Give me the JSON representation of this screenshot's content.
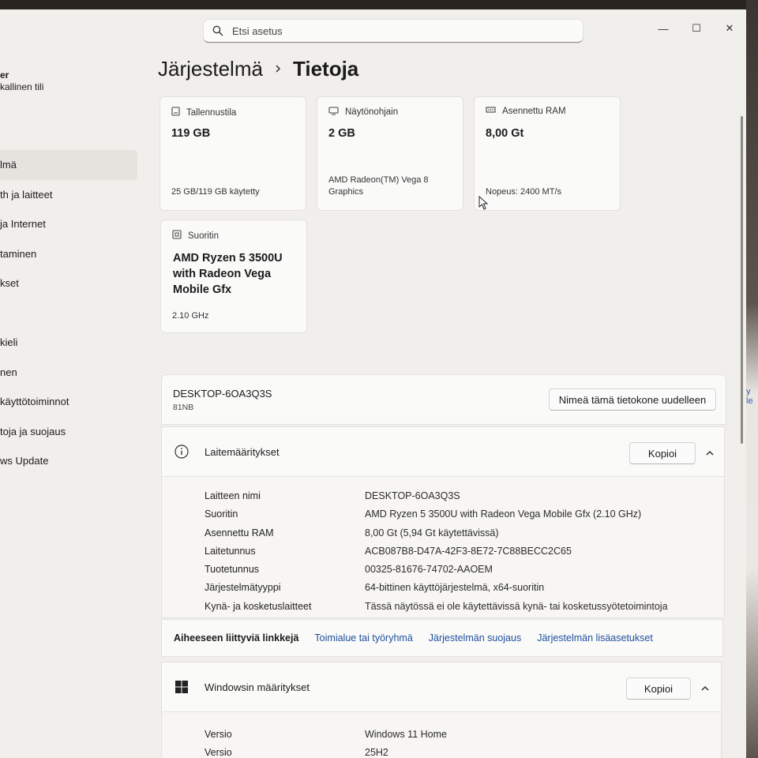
{
  "search": {
    "placeholder": "Etsi asetus"
  },
  "window_controls": {
    "minimize": "—",
    "maximize": "☐",
    "close": "✕"
  },
  "sidebar": {
    "user_name": "er",
    "user_sub": "kallinen tili",
    "items": [
      {
        "label": "lmä",
        "active": true
      },
      {
        "label": "th ja laitteet"
      },
      {
        "label": "ja Internet"
      },
      {
        "label": "taminen"
      },
      {
        "label": "kset"
      },
      {
        "label": ""
      },
      {
        "label": "kieli"
      },
      {
        "label": "nen"
      },
      {
        "label": "käyttötoiminnot"
      },
      {
        "label": "toja ja suojaus"
      },
      {
        "label": "ws Update"
      }
    ]
  },
  "breadcrumb": {
    "parent": "Järjestelmä",
    "current": "Tietoja"
  },
  "cards": {
    "storage": {
      "label": "Tallennustila",
      "value": "119 GB",
      "sub": "25 GB/119 GB käytetty"
    },
    "gpu": {
      "label": "Näytönohjain",
      "value": "2 GB",
      "sub": "AMD Radeon(TM) Vega 8 Graphics"
    },
    "ram": {
      "label": "Asennettu RAM",
      "value": "8,00 Gt",
      "sub": "Nopeus: 2400 MT/s"
    },
    "cpu": {
      "label": "Suoritin",
      "value": "AMD Ryzen 5 3500U with Radeon Vega Mobile Gfx",
      "sub": "2.10 GHz"
    }
  },
  "device": {
    "name": "DESKTOP-6OA3Q3S",
    "model": "81NB",
    "rename_button": "Nimeä tämä tietokone uudelleen"
  },
  "device_specs": {
    "title": "Laitemääritykset",
    "copy_button": "Kopioi",
    "rows": [
      {
        "key": "Laitteen nimi",
        "value": "DESKTOP-6OA3Q3S"
      },
      {
        "key": "Suoritin",
        "value": "AMD Ryzen 5 3500U with Radeon Vega Mobile Gfx   (2.10 GHz)"
      },
      {
        "key": "Asennettu RAM",
        "value": "8,00 Gt (5,94 Gt käytettävissä)"
      },
      {
        "key": "Laitetunnus",
        "value": "ACB087B8-D47A-42F3-8E72-7C88BECC2C65"
      },
      {
        "key": "Tuotetunnus",
        "value": "00325-81676-74702-AAOEM"
      },
      {
        "key": "Järjestelmätyyppi",
        "value": "64-bittinen käyttöjärjestelmä, x64-suoritin"
      },
      {
        "key": "Kynä- ja kosketuslaitteet",
        "value": "Tässä näytössä ei ole käytettävissä kynä- tai kosketussyötetoimintoja"
      }
    ]
  },
  "related_links": {
    "heading": "Aiheeseen liittyviä linkkejä",
    "links": [
      "Toimialue tai työryhmä",
      "Järjestelmän suojaus",
      "Järjestelmän lisäasetukset"
    ]
  },
  "windows_specs": {
    "title": "Windowsin määritykset",
    "copy_button": "Kopioi",
    "rows": [
      {
        "key": "Versio",
        "value": "Windows 11 Home"
      },
      {
        "key": "Versio",
        "value": "25H2"
      }
    ]
  },
  "right_edge_text": "y le",
  "colors": {
    "background": "#f1efec",
    "card": "#fafaf9",
    "link": "#1f4f9e",
    "accent": "#005fb8"
  }
}
